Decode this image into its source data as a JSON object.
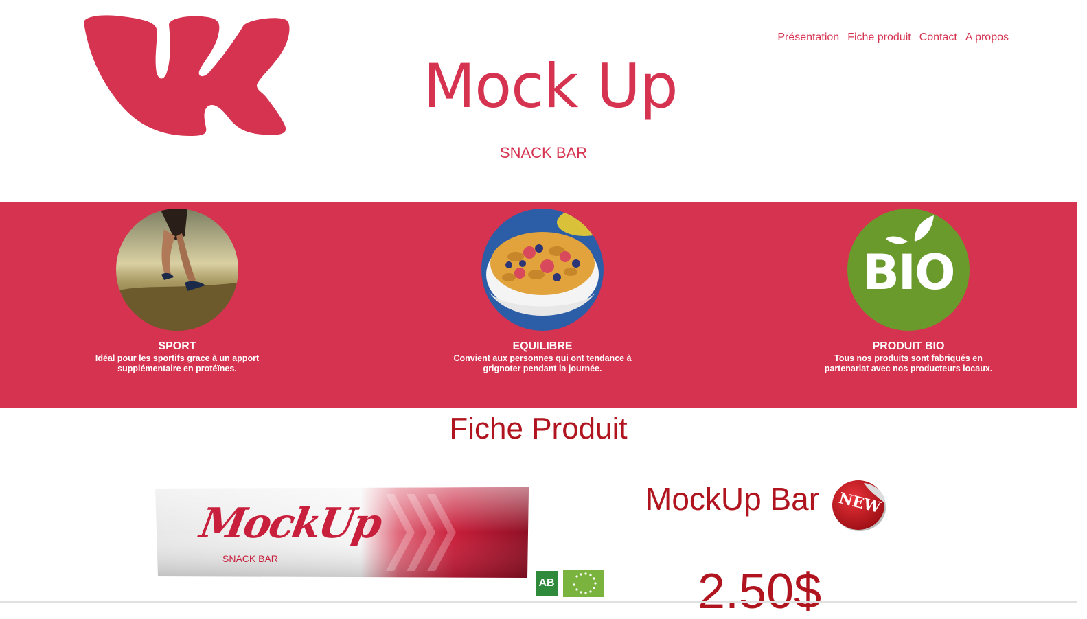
{
  "nav": {
    "items": [
      "Présentation",
      "Fiche produit",
      "Contact",
      "A propos"
    ]
  },
  "header": {
    "title": "Mock Up",
    "subtitle": "SNACK BAR",
    "logo": "vk-logo-icon"
  },
  "colors": {
    "brand": "#d53350",
    "dark_red": "#b0141e",
    "bio_green": "#6a9a2c"
  },
  "features": [
    {
      "title": "SPORT",
      "line1": "Idéal pour les sportifs grace à un apport",
      "line2": "supplémentaire en protéïnes.",
      "icon": "runner-photo"
    },
    {
      "title": "EQUILIBRE",
      "line1": "Convient aux personnes qui ont tendance à",
      "line2": "grignoter pendant la journée.",
      "icon": "cereal-bowl-photo"
    },
    {
      "title": "PRODUIT BIO",
      "line1": "Tous nos produits sont fabriqués en",
      "line2": "partenariat avec nos producteurs locaux.",
      "icon": "bio-badge",
      "badge_text": "BIO"
    }
  ],
  "product_section": {
    "title": "Fiche Produit",
    "product_name": "MockUp Bar",
    "badge": "NEW",
    "price": "2.50$",
    "wrapper_brand": "MockUp",
    "wrapper_sub": "SNACK BAR",
    "ab_label": "AB"
  }
}
